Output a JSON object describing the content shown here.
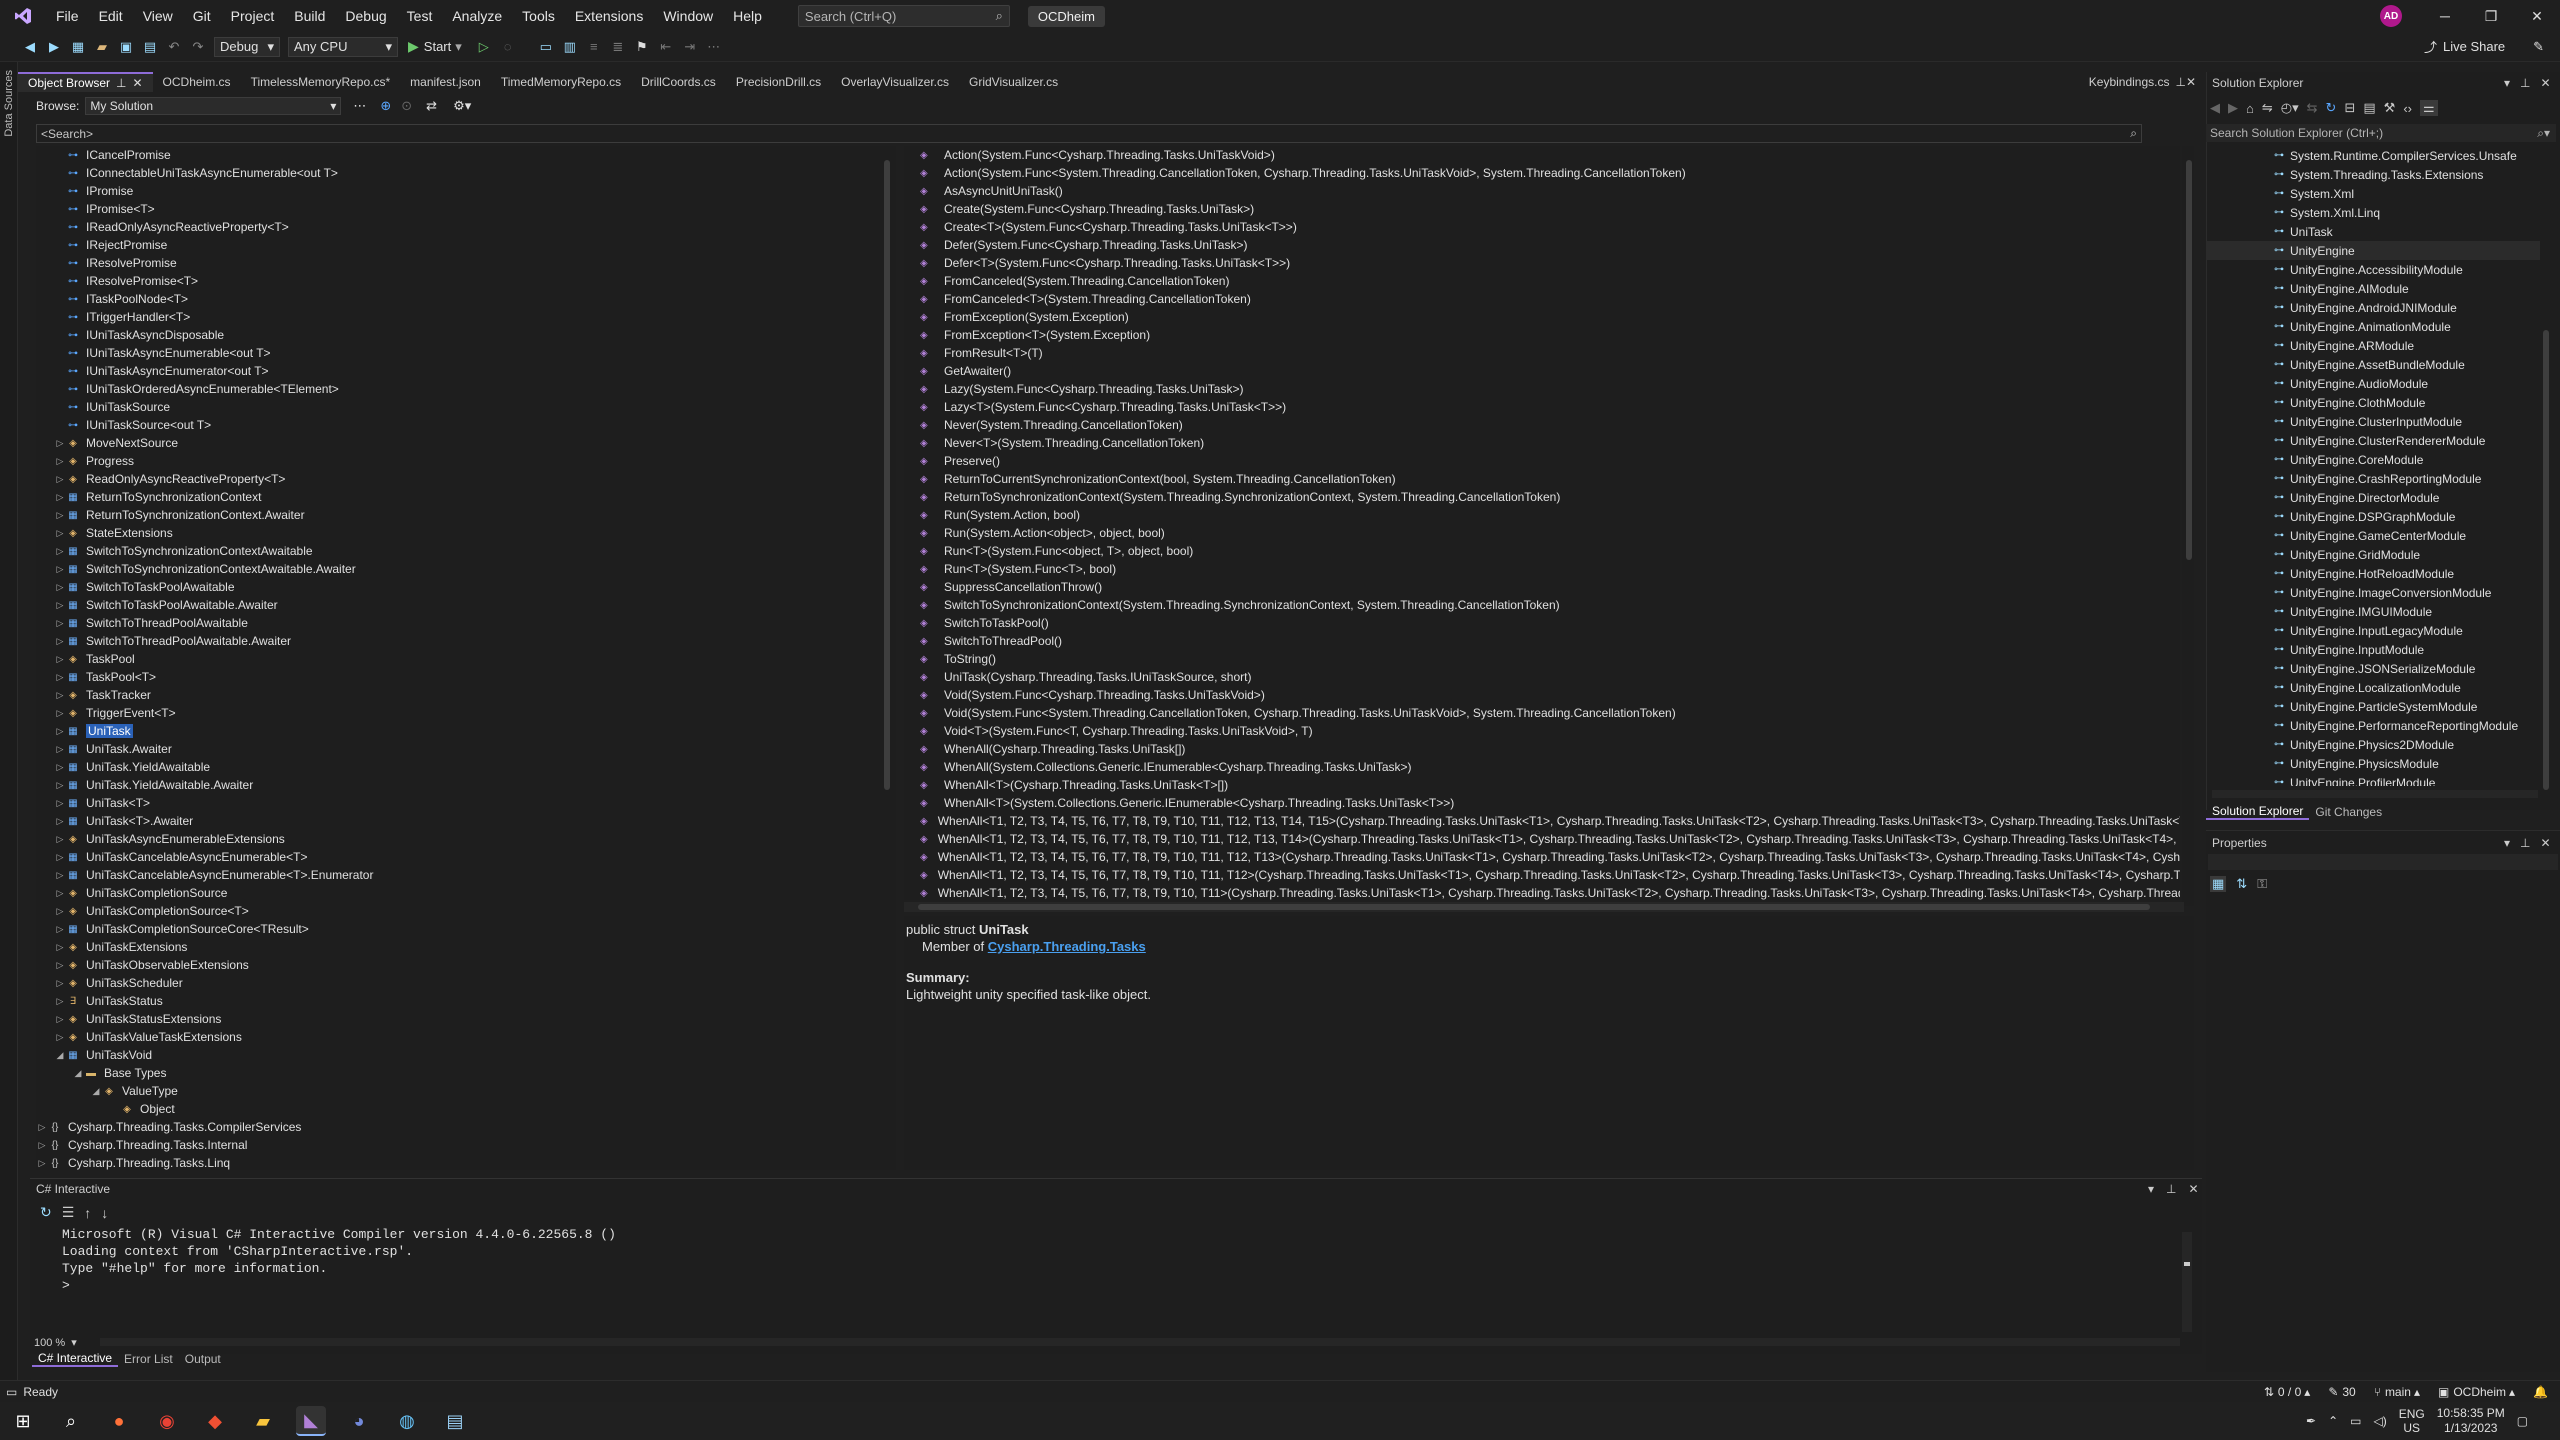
{
  "menubar": {
    "items": [
      "File",
      "Edit",
      "View",
      "Git",
      "Project",
      "Build",
      "Debug",
      "Test",
      "Analyze",
      "Tools",
      "Extensions",
      "Window",
      "Help"
    ],
    "search_placeholder": "Search (Ctrl+Q)",
    "solution_name": "OCDheim",
    "avatar_initials": "AD",
    "window_controls": [
      "minimize",
      "restore",
      "close"
    ]
  },
  "toolbar": {
    "configuration": "Debug",
    "platform": "Any CPU",
    "start_label": "Start",
    "live_share": "Live Share"
  },
  "left_strip": {
    "label": "Data Sources"
  },
  "doc_tabs": [
    {
      "label": "Object Browser",
      "active": true
    },
    {
      "label": "OCDheim.cs"
    },
    {
      "label": "TimelessMemoryRepo.cs*"
    },
    {
      "label": "manifest.json"
    },
    {
      "label": "TimedMemoryRepo.cs"
    },
    {
      "label": "DrillCoords.cs"
    },
    {
      "label": "PrecisionDrill.cs"
    },
    {
      "label": "OverlayVisualizer.cs"
    },
    {
      "label": "GridVisualizer.cs"
    },
    {
      "label": "Keybindings.cs",
      "pinned_right": true
    }
  ],
  "object_browser": {
    "browse_label": "Browse:",
    "browse_value": "My Solution",
    "search_placeholder": "<Search>",
    "tree": [
      {
        "indent": 1,
        "icon": "interface",
        "label": "ICancelPromise"
      },
      {
        "indent": 1,
        "icon": "interface",
        "label": "IConnectableUniTaskAsyncEnumerable<out T>"
      },
      {
        "indent": 1,
        "icon": "interface",
        "label": "IPromise"
      },
      {
        "indent": 1,
        "icon": "interface",
        "label": "IPromise<T>"
      },
      {
        "indent": 1,
        "icon": "interface",
        "label": "IReadOnlyAsyncReactiveProperty<T>"
      },
      {
        "indent": 1,
        "icon": "interface",
        "label": "IRejectPromise"
      },
      {
        "indent": 1,
        "icon": "interface",
        "label": "IResolvePromise"
      },
      {
        "indent": 1,
        "icon": "interface",
        "label": "IResolvePromise<T>"
      },
      {
        "indent": 1,
        "icon": "interface",
        "label": "ITaskPoolNode<T>"
      },
      {
        "indent": 1,
        "icon": "interface",
        "label": "ITriggerHandler<T>"
      },
      {
        "indent": 1,
        "icon": "interface",
        "label": "IUniTaskAsyncDisposable"
      },
      {
        "indent": 1,
        "icon": "interface",
        "label": "IUniTaskAsyncEnumerable<out T>"
      },
      {
        "indent": 1,
        "icon": "interface",
        "label": "IUniTaskAsyncEnumerator<out T>"
      },
      {
        "indent": 1,
        "icon": "interface",
        "label": "IUniTaskOrderedAsyncEnumerable<TElement>"
      },
      {
        "indent": 1,
        "icon": "interface",
        "label": "IUniTaskSource"
      },
      {
        "indent": 1,
        "icon": "interface",
        "label": "IUniTaskSource<out T>"
      },
      {
        "indent": 1,
        "icon": "class",
        "label": "MoveNextSource",
        "exp": "▷"
      },
      {
        "indent": 1,
        "icon": "class",
        "label": "Progress",
        "exp": "▷"
      },
      {
        "indent": 1,
        "icon": "class",
        "label": "ReadOnlyAsyncReactiveProperty<T>",
        "exp": "▷"
      },
      {
        "indent": 1,
        "icon": "struct",
        "label": "ReturnToSynchronizationContext",
        "exp": "▷"
      },
      {
        "indent": 1,
        "icon": "struct",
        "label": "ReturnToSynchronizationContext.Awaiter",
        "exp": "▷"
      },
      {
        "indent": 1,
        "icon": "class",
        "label": "StateExtensions",
        "exp": "▷"
      },
      {
        "indent": 1,
        "icon": "struct",
        "label": "SwitchToSynchronizationContextAwaitable",
        "exp": "▷"
      },
      {
        "indent": 1,
        "icon": "struct",
        "label": "SwitchToSynchronizationContextAwaitable.Awaiter",
        "exp": "▷"
      },
      {
        "indent": 1,
        "icon": "struct",
        "label": "SwitchToTaskPoolAwaitable",
        "exp": "▷"
      },
      {
        "indent": 1,
        "icon": "struct",
        "label": "SwitchToTaskPoolAwaitable.Awaiter",
        "exp": "▷"
      },
      {
        "indent": 1,
        "icon": "struct",
        "label": "SwitchToThreadPoolAwaitable",
        "exp": "▷"
      },
      {
        "indent": 1,
        "icon": "struct",
        "label": "SwitchToThreadPoolAwaitable.Awaiter",
        "exp": "▷"
      },
      {
        "indent": 1,
        "icon": "class",
        "label": "TaskPool",
        "exp": "▷"
      },
      {
        "indent": 1,
        "icon": "struct",
        "label": "TaskPool<T>",
        "exp": "▷"
      },
      {
        "indent": 1,
        "icon": "class",
        "label": "TaskTracker",
        "exp": "▷"
      },
      {
        "indent": 1,
        "icon": "class",
        "label": "TriggerEvent<T>",
        "exp": "▷"
      },
      {
        "indent": 1,
        "icon": "struct",
        "label": "UniTask",
        "exp": "▷",
        "selected": true
      },
      {
        "indent": 1,
        "icon": "struct",
        "label": "UniTask.Awaiter",
        "exp": "▷"
      },
      {
        "indent": 1,
        "icon": "struct",
        "label": "UniTask.YieldAwaitable",
        "exp": "▷"
      },
      {
        "indent": 1,
        "icon": "struct",
        "label": "UniTask.YieldAwaitable.Awaiter",
        "exp": "▷"
      },
      {
        "indent": 1,
        "icon": "struct",
        "label": "UniTask<T>",
        "exp": "▷"
      },
      {
        "indent": 1,
        "icon": "struct",
        "label": "UniTask<T>.Awaiter",
        "exp": "▷"
      },
      {
        "indent": 1,
        "icon": "class",
        "label": "UniTaskAsyncEnumerableExtensions",
        "exp": "▷"
      },
      {
        "indent": 1,
        "icon": "struct",
        "label": "UniTaskCancelableAsyncEnumerable<T>",
        "exp": "▷"
      },
      {
        "indent": 1,
        "icon": "struct",
        "label": "UniTaskCancelableAsyncEnumerable<T>.Enumerator",
        "exp": "▷"
      },
      {
        "indent": 1,
        "icon": "class",
        "label": "UniTaskCompletionSource",
        "exp": "▷"
      },
      {
        "indent": 1,
        "icon": "class",
        "label": "UniTaskCompletionSource<T>",
        "exp": "▷"
      },
      {
        "indent": 1,
        "icon": "struct",
        "label": "UniTaskCompletionSourceCore<TResult>",
        "exp": "▷"
      },
      {
        "indent": 1,
        "icon": "class",
        "label": "UniTaskExtensions",
        "exp": "▷"
      },
      {
        "indent": 1,
        "icon": "class",
        "label": "UniTaskObservableExtensions",
        "exp": "▷"
      },
      {
        "indent": 1,
        "icon": "class",
        "label": "UniTaskScheduler",
        "exp": "▷"
      },
      {
        "indent": 1,
        "icon": "enum",
        "label": "UniTaskStatus",
        "exp": "▷"
      },
      {
        "indent": 1,
        "icon": "class",
        "label": "UniTaskStatusExtensions",
        "exp": "▷"
      },
      {
        "indent": 1,
        "icon": "class",
        "label": "UniTaskValueTaskExtensions",
        "exp": "▷"
      },
      {
        "indent": 1,
        "icon": "struct",
        "label": "UniTaskVoid",
        "exp": "◢"
      },
      {
        "indent": 2,
        "icon": "folder",
        "label": "Base Types",
        "exp": "◢"
      },
      {
        "indent": 3,
        "icon": "class",
        "label": "ValueType",
        "exp": "◢"
      },
      {
        "indent": 4,
        "icon": "class",
        "label": "Object"
      },
      {
        "indent": 0,
        "icon": "ns",
        "label": "Cysharp.Threading.Tasks.CompilerServices",
        "exp": "▷"
      },
      {
        "indent": 0,
        "icon": "ns",
        "label": "Cysharp.Threading.Tasks.Internal",
        "exp": "▷"
      },
      {
        "indent": 0,
        "icon": "ns",
        "label": "Cysharp.Threading.Tasks.Linq",
        "exp": "▷"
      }
    ],
    "members": [
      "Action(System.Func<Cysharp.Threading.Tasks.UniTaskVoid>)",
      "Action(System.Func<System.Threading.CancellationToken, Cysharp.Threading.Tasks.UniTaskVoid>, System.Threading.CancellationToken)",
      "AsAsyncUnitUniTask()",
      "Create(System.Func<Cysharp.Threading.Tasks.UniTask>)",
      "Create<T>(System.Func<Cysharp.Threading.Tasks.UniTask<T>>)",
      "Defer(System.Func<Cysharp.Threading.Tasks.UniTask>)",
      "Defer<T>(System.Func<Cysharp.Threading.Tasks.UniTask<T>>)",
      "FromCanceled(System.Threading.CancellationToken)",
      "FromCanceled<T>(System.Threading.CancellationToken)",
      "FromException(System.Exception)",
      "FromException<T>(System.Exception)",
      "FromResult<T>(T)",
      "GetAwaiter()",
      "Lazy(System.Func<Cysharp.Threading.Tasks.UniTask>)",
      "Lazy<T>(System.Func<Cysharp.Threading.Tasks.UniTask<T>>)",
      "Never(System.Threading.CancellationToken)",
      "Never<T>(System.Threading.CancellationToken)",
      "Preserve()",
      "ReturnToCurrentSynchronizationContext(bool, System.Threading.CancellationToken)",
      "ReturnToSynchronizationContext(System.Threading.SynchronizationContext, System.Threading.CancellationToken)",
      "Run(System.Action, bool)",
      "Run(System.Action<object>, object, bool)",
      "Run<T>(System.Func<object, T>, object, bool)",
      "Run<T>(System.Func<T>, bool)",
      "SuppressCancellationThrow()",
      "SwitchToSynchronizationContext(System.Threading.SynchronizationContext, System.Threading.CancellationToken)",
      "SwitchToTaskPool()",
      "SwitchToThreadPool()",
      "ToString()",
      "UniTask(Cysharp.Threading.Tasks.IUniTaskSource, short)",
      "Void(System.Func<Cysharp.Threading.Tasks.UniTaskVoid>)",
      "Void(System.Func<System.Threading.CancellationToken, Cysharp.Threading.Tasks.UniTaskVoid>, System.Threading.CancellationToken)",
      "Void<T>(System.Func<T, Cysharp.Threading.Tasks.UniTaskVoid>, T)",
      "WhenAll(Cysharp.Threading.Tasks.UniTask[])",
      "WhenAll(System.Collections.Generic.IEnumerable<Cysharp.Threading.Tasks.UniTask>)",
      "WhenAll<T>(Cysharp.Threading.Tasks.UniTask<T>[])",
      "WhenAll<T>(System.Collections.Generic.IEnumerable<Cysharp.Threading.Tasks.UniTask<T>>)",
      "WhenAll<T1, T2, T3, T4, T5, T6, T7, T8, T9, T10, T11, T12, T13, T14, T15>(Cysharp.Threading.Tasks.UniTask<T1>, Cysharp.Threading.Tasks.UniTask<T2>, Cysharp.Threading.Tasks.UniTask<T3>, Cysharp.Threading.Tasks.UniTask<T4>, Cysharp",
      "WhenAll<T1, T2, T3, T4, T5, T6, T7, T8, T9, T10, T11, T12, T13, T14>(Cysharp.Threading.Tasks.UniTask<T1>, Cysharp.Threading.Tasks.UniTask<T2>, Cysharp.Threading.Tasks.UniTask<T3>, Cysharp.Threading.Tasks.UniTask<T4>, Cysharp.Thre",
      "WhenAll<T1, T2, T3, T4, T5, T6, T7, T8, T9, T10, T11, T12, T13>(Cysharp.Threading.Tasks.UniTask<T1>, Cysharp.Threading.Tasks.UniTask<T2>, Cysharp.Threading.Tasks.UniTask<T3>, Cysharp.Threading.Tasks.UniTask<T4>, Cysharp.Threadin",
      "WhenAll<T1, T2, T3, T4, T5, T6, T7, T8, T9, T10, T11, T12>(Cysharp.Threading.Tasks.UniTask<T1>, Cysharp.Threading.Tasks.UniTask<T2>, Cysharp.Threading.Tasks.UniTask<T3>, Cysharp.Threading.Tasks.UniTask<T4>, Cysharp.Threading.Ta",
      "WhenAll<T1, T2, T3, T4, T5, T6, T7, T8, T9, T10, T11>(Cysharp.Threading.Tasks.UniTask<T1>, Cysharp.Threading.Tasks.UniTask<T2>, Cysharp.Threading.Tasks.UniTask<T3>, Cysharp.Threading.Tasks.UniTask<T4>, Cysharp.Threading.Tasks.U"
    ],
    "description": {
      "signature_prefix": "public struct",
      "signature_name": "UniTask",
      "member_of_label": "Member of",
      "member_of_link": "Cysharp.Threading.Tasks",
      "summary_label": "Summary:",
      "summary_text": "Lightweight unity specified task-like object."
    }
  },
  "interactive": {
    "title": "C# Interactive",
    "lines": [
      "Microsoft (R) Visual C# Interactive Compiler version 4.4.0-6.22565.8 ()",
      "Loading context from 'CSharpInteractive.rsp'.",
      "Type \"#help\" for more information.",
      ">"
    ],
    "zoom": "100 %",
    "bottom_tabs": [
      "C# Interactive",
      "Error List",
      "Output"
    ]
  },
  "solution_explorer": {
    "title": "Solution Explorer",
    "search_placeholder": "Search Solution Explorer (Ctrl+;)",
    "items": [
      "System.Runtime.CompilerServices.Unsafe",
      "System.Threading.Tasks.Extensions",
      "System.Xml",
      "System.Xml.Linq",
      "UniTask",
      "UnityEngine",
      "UnityEngine.AccessibilityModule",
      "UnityEngine.AIModule",
      "UnityEngine.AndroidJNIModule",
      "UnityEngine.AnimationModule",
      "UnityEngine.ARModule",
      "UnityEngine.AssetBundleModule",
      "UnityEngine.AudioModule",
      "UnityEngine.ClothModule",
      "UnityEngine.ClusterInputModule",
      "UnityEngine.ClusterRendererModule",
      "UnityEngine.CoreModule",
      "UnityEngine.CrashReportingModule",
      "UnityEngine.DirectorModule",
      "UnityEngine.DSPGraphModule",
      "UnityEngine.GameCenterModule",
      "UnityEngine.GridModule",
      "UnityEngine.HotReloadModule",
      "UnityEngine.ImageConversionModule",
      "UnityEngine.IMGUIModule",
      "UnityEngine.InputLegacyModule",
      "UnityEngine.InputModule",
      "UnityEngine.JSONSerializeModule",
      "UnityEngine.LocalizationModule",
      "UnityEngine.ParticleSystemModule",
      "UnityEngine.PerformanceReportingModule",
      "UnityEngine.Physics2DModule",
      "UnityEngine.PhysicsModule",
      "UnityEngine.ProfilerModule"
    ],
    "selected_index": 5,
    "tabs": [
      "Solution Explorer",
      "Git Changes"
    ]
  },
  "properties": {
    "title": "Properties"
  },
  "statusbar": {
    "ready": "Ready",
    "changes": "0 / 0",
    "edits": "30",
    "branch": "main",
    "repo": "OCDheim"
  },
  "taskbar": {
    "apps": [
      "windows-start",
      "search",
      "firefox",
      "chrome",
      "git",
      "file-explorer",
      "visual-studio",
      "discord",
      "steam",
      "notepad"
    ],
    "lang": "ENG",
    "region": "US",
    "time": "10:58:35 PM",
    "date": "1/13/2023"
  }
}
